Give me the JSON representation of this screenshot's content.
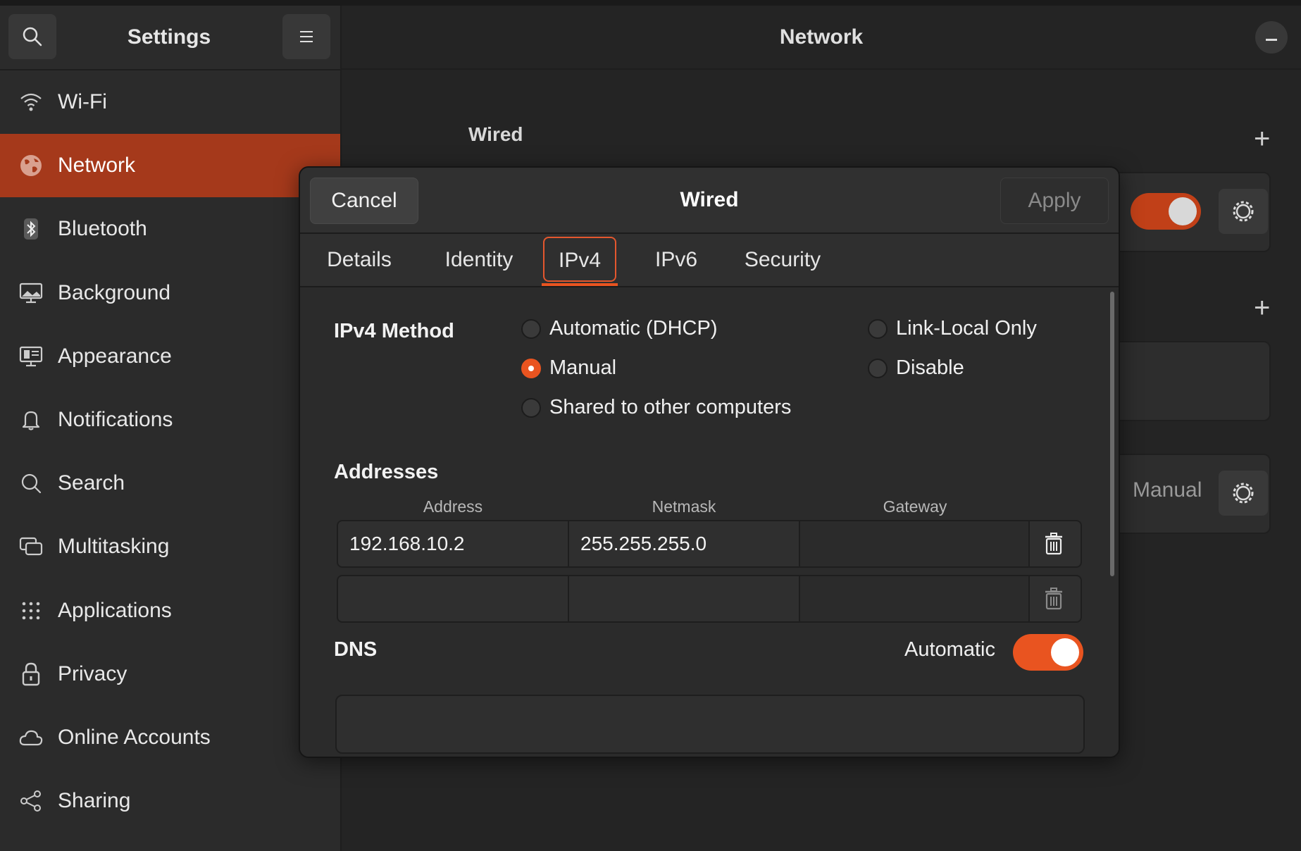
{
  "sidebar": {
    "title": "Settings",
    "items": [
      {
        "label": "Wi-Fi",
        "icon": "wifi-icon"
      },
      {
        "label": "Network",
        "icon": "network-globe-icon",
        "active": true
      },
      {
        "label": "Bluetooth",
        "icon": "bluetooth-icon"
      },
      {
        "label": "Background",
        "icon": "background-monitor-icon"
      },
      {
        "label": "Appearance",
        "icon": "appearance-icon"
      },
      {
        "label": "Notifications",
        "icon": "bell-icon"
      },
      {
        "label": "Search",
        "icon": "search-icon"
      },
      {
        "label": "Multitasking",
        "icon": "multitasking-icon"
      },
      {
        "label": "Applications",
        "icon": "grid-icon"
      },
      {
        "label": "Privacy",
        "icon": "lock-icon"
      },
      {
        "label": "Online Accounts",
        "icon": "cloud-icon"
      },
      {
        "label": "Sharing",
        "icon": "share-icon"
      }
    ]
  },
  "main": {
    "title": "Network",
    "wired_heading": "Wired",
    "manual_label": "Manual"
  },
  "dialog": {
    "title": "Wired",
    "cancel_label": "Cancel",
    "apply_label": "Apply",
    "tabs": [
      "Details",
      "Identity",
      "IPv4",
      "IPv6",
      "Security"
    ],
    "active_tab": "IPv4",
    "ipv4_method": {
      "label": "IPv4 Method",
      "options": [
        {
          "label": "Automatic (DHCP)",
          "selected": false
        },
        {
          "label": "Manual",
          "selected": true
        },
        {
          "label": "Shared to other computers",
          "selected": false
        },
        {
          "label": "Link-Local Only",
          "selected": false
        },
        {
          "label": "Disable",
          "selected": false
        }
      ]
    },
    "addresses": {
      "label": "Addresses",
      "columns": [
        "Address",
        "Netmask",
        "Gateway"
      ],
      "rows": [
        {
          "address": "192.168.10.2",
          "netmask": "255.255.255.0",
          "gateway": ""
        },
        {
          "address": "",
          "netmask": "",
          "gateway": ""
        }
      ]
    },
    "dns": {
      "label": "DNS",
      "automatic_label": "Automatic",
      "automatic": true
    }
  },
  "colors": {
    "accent": "#e95420",
    "sidebar_active": "#a5391b",
    "background": "#242424"
  }
}
